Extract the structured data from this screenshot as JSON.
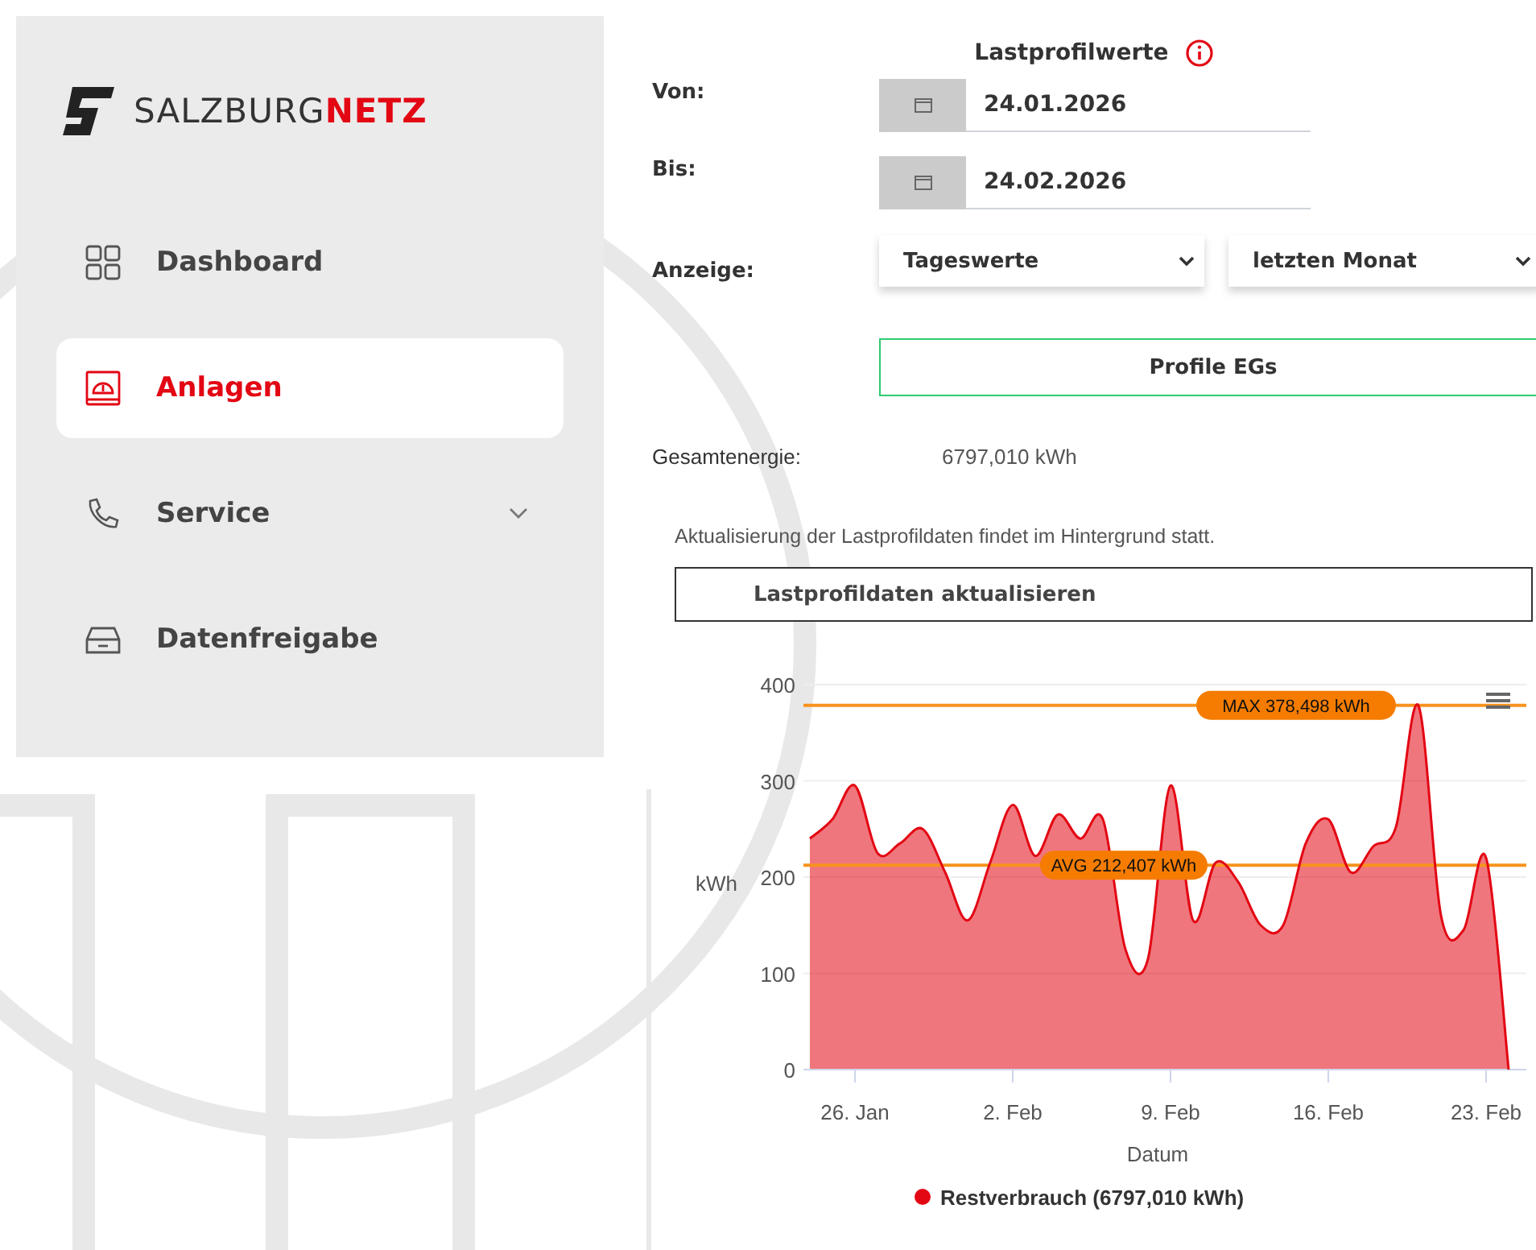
{
  "logo": {
    "prefix": "SALZBURG",
    "suffix": "NETZ"
  },
  "sidebar": {
    "items": [
      {
        "label": "Dashboard",
        "kind": "link",
        "selected": false
      },
      {
        "label": "Anlagen",
        "kind": "link",
        "selected": true
      },
      {
        "label": "Service",
        "kind": "group",
        "selected": false,
        "expanded": false
      },
      {
        "label": "Datenfreigabe",
        "kind": "link",
        "selected": false
      }
    ]
  },
  "panel": {
    "title": "Lastprofilwerte",
    "from": {
      "label": "Von:",
      "value": "24.01.2026"
    },
    "to": {
      "label": "Bis:",
      "value": "24.02.2026"
    },
    "display": {
      "label": "Anzeige:",
      "resolution": "Tageswerte",
      "period": "letzten Monat"
    },
    "profile_button": "Profile EGs",
    "total": {
      "label": "Gesamtenergie:",
      "value": "6797,010 kWh"
    },
    "note": "Aktualisierung der Lastprofildaten findet im Hintergrund statt.",
    "refresh_button": "Lastprofildaten aktualisieren",
    "chart_data": {
      "type": "area",
      "xlabel": "Datum",
      "ylabel": "kWh",
      "categories": [
        null,
        null,
        "26. Jan",
        null,
        null,
        null,
        null,
        null,
        null,
        "2. Feb",
        null,
        null,
        null,
        null,
        null,
        null,
        "9. Feb",
        null,
        null,
        null,
        null,
        null,
        null,
        "16. Feb",
        null,
        null,
        null,
        null,
        null,
        null,
        "23. Feb",
        null
      ],
      "grid": true,
      "series": [
        {
          "name": "Restverbrauch (6797,010 kWh)",
          "color": "#e30613",
          "values": [
            240,
            260,
            295,
            225,
            235,
            250,
            205,
            155,
            215,
            275,
            222,
            265,
            240,
            260,
            125,
            115,
            295,
            155,
            215,
            195,
            150,
            150,
            235,
            260,
            205,
            232,
            252,
            378,
            160,
            145,
            220,
            0
          ]
        }
      ],
      "ylim": [
        0,
        400
      ],
      "yticks": [
        0,
        100,
        200,
        300,
        400
      ],
      "ref_lines": [
        {
          "axis": "y",
          "value": 378.498,
          "label": "MAX 378,498 kWh"
        },
        {
          "axis": "y",
          "value": 212.407,
          "label": "AVG 212,407 kWh"
        }
      ]
    }
  }
}
